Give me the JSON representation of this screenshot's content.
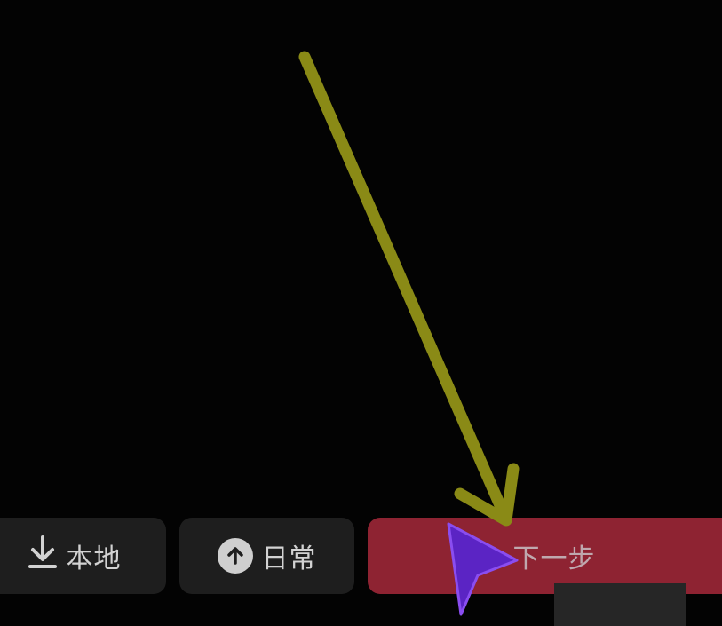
{
  "toolbar": {
    "local_label": "本地",
    "local_icon": "download-icon",
    "daily_label": "日常",
    "daily_icon": "upload-circle-icon",
    "next_label": "下一步"
  },
  "annotation": {
    "arrow_icon": "annotation-arrow-icon",
    "cursor_icon": "pointer-cursor-icon",
    "arrow_color": "#8a8a16",
    "cursor_color": "#6a2bd0"
  },
  "colors": {
    "background": "#030303",
    "button_dark": "#1e1e1e",
    "button_primary": "#8e2332"
  }
}
